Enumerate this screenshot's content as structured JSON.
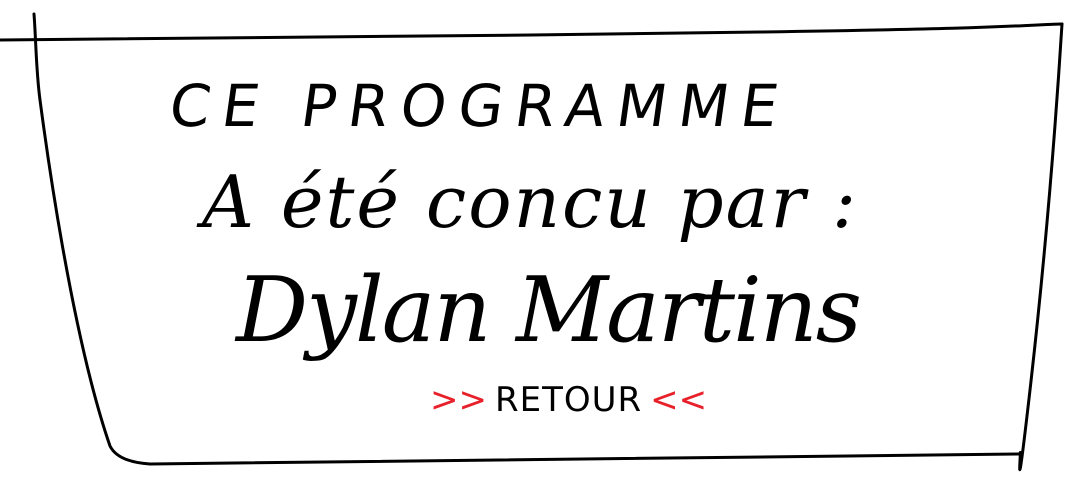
{
  "screen": {
    "line1": "CE PROGRAMME",
    "line2": "A été concu par :",
    "author": "Dylan Martins"
  },
  "back_link": {
    "left_arrows": ">>",
    "label": "RETOUR",
    "right_arrows": "<<"
  },
  "colors": {
    "ink": "#000000",
    "accent": "#e8202a",
    "background": "#ffffff"
  }
}
